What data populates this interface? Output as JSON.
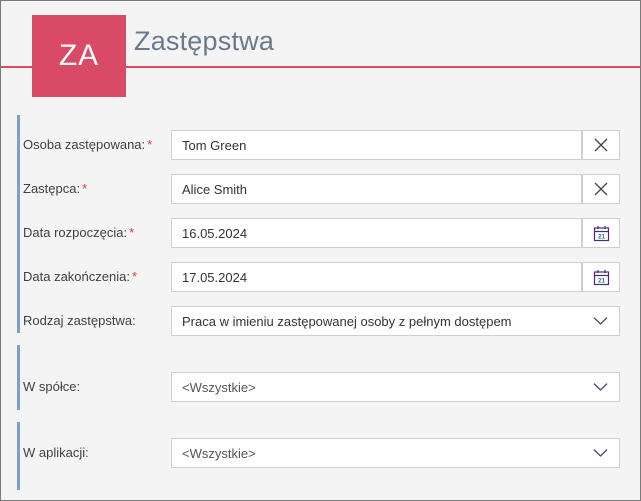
{
  "window": {
    "background": "#f4f4f4",
    "border_color": "#7a7a7a"
  },
  "header": {
    "avatar_initials": "ZA",
    "avatar_color": "#d94a66",
    "rule_color": "#d94a66",
    "title": "Zastępstwa",
    "title_color": "#6a7a8c"
  },
  "form": {
    "accent_color": "#6ba4de",
    "required_marker": "*",
    "groups": [
      {
        "name": "primary-group",
        "fields": [
          {
            "label": "Osoba zastępowana:",
            "required": true,
            "type": "text",
            "value": "Tom Green",
            "action_icon": "close-icon"
          },
          {
            "label": "Zastępca:",
            "required": true,
            "type": "text",
            "value": "Alice Smith",
            "action_icon": "close-icon"
          },
          {
            "label": "Data rozpoczęcia:",
            "required": true,
            "type": "date",
            "value": "16.05.2024",
            "action_icon": "calendar-icon",
            "calendar_day": "21"
          },
          {
            "label": "Data zakończenia:",
            "required": true,
            "type": "date",
            "value": "17.05.2024",
            "action_icon": "calendar-icon",
            "calendar_day": "21"
          },
          {
            "label": "Rodzaj zastępstwa:",
            "required": false,
            "type": "select",
            "value": "Praca w imieniu zastępowanej osoby z pełnym dostępem",
            "action_icon": "chevron-down-icon"
          }
        ]
      },
      {
        "name": "company-group",
        "fields": [
          {
            "label": "W spółce:",
            "required": false,
            "type": "select",
            "value": "<Wszystkie>",
            "action_icon": "chevron-down-icon"
          }
        ]
      },
      {
        "name": "application-group",
        "fields": [
          {
            "label": "W aplikacji:",
            "required": false,
            "type": "select",
            "value": "<Wszystkie>",
            "action_icon": "chevron-down-icon"
          }
        ]
      }
    ]
  }
}
